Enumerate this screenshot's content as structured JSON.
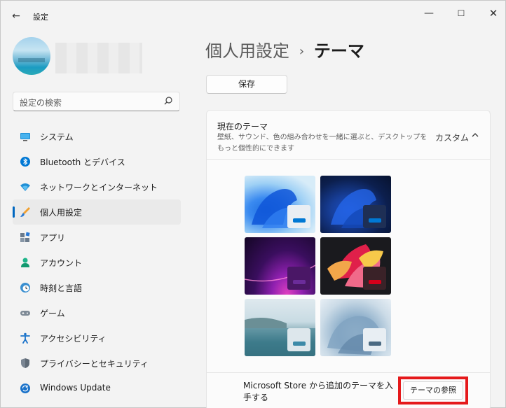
{
  "window": {
    "title": "設定",
    "controls": {
      "minimize": "—",
      "maximize": "☐",
      "close": "✕"
    },
    "back": "←"
  },
  "sidebar": {
    "search": {
      "placeholder": "設定の検索"
    },
    "items": [
      {
        "label": "システム",
        "icon": "system-icon",
        "active": false
      },
      {
        "label": "Bluetooth とデバイス",
        "icon": "bluetooth-icon",
        "active": false
      },
      {
        "label": "ネットワークとインターネット",
        "icon": "wifi-icon",
        "active": false
      },
      {
        "label": "個人用設定",
        "icon": "brush-icon",
        "active": true
      },
      {
        "label": "アプリ",
        "icon": "apps-icon",
        "active": false
      },
      {
        "label": "アカウント",
        "icon": "account-icon",
        "active": false
      },
      {
        "label": "時刻と言語",
        "icon": "time-language-icon",
        "active": false
      },
      {
        "label": "ゲーム",
        "icon": "gamepad-icon",
        "active": false
      },
      {
        "label": "アクセシビリティ",
        "icon": "accessibility-icon",
        "active": false
      },
      {
        "label": "プライバシーとセキュリティ",
        "icon": "shield-icon",
        "active": false
      },
      {
        "label": "Windows Update",
        "icon": "update-icon",
        "active": false
      }
    ]
  },
  "main": {
    "breadcrumb": {
      "parent": "個人用設定",
      "separator": "›",
      "current": "テーマ"
    },
    "save_label": "保存",
    "current_theme": {
      "title": "現在のテーマ",
      "description": "壁紙、サウンド、色の組み合わせを一緒に選ぶと、デスクトップをもっと個性的にできます",
      "value": "カスタム"
    },
    "themes": [
      {
        "name": "light-bloom",
        "accent": "#0078d4"
      },
      {
        "name": "dark-bloom",
        "accent": "#0078d4"
      },
      {
        "name": "glow",
        "accent": "#6b2c9a"
      },
      {
        "name": "captured-motion",
        "accent": "#d4001a"
      },
      {
        "name": "sunrise",
        "accent": "#3c8aa8"
      },
      {
        "name": "flow",
        "accent": "#4b6a82"
      }
    ],
    "store": {
      "text": "Microsoft Store から追加のテーマを入手する",
      "button": "テーマの参照"
    }
  },
  "colors": {
    "accent": "#0067c0",
    "highlight": "#e5191b"
  }
}
